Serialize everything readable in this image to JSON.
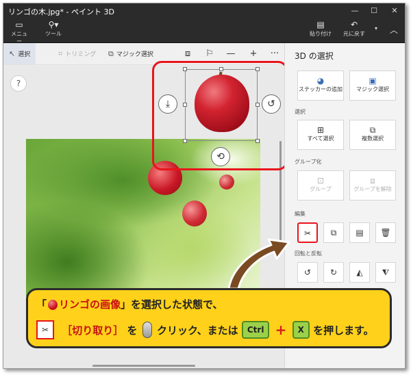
{
  "window": {
    "title": "リンゴの木.jpg* - ペイント 3D"
  },
  "ribbon": {
    "menu_label": "メニュー",
    "tools_label": "ツール",
    "paste_label": "貼り付け",
    "undo_label": "元に戻す"
  },
  "toolbar": {
    "select_label": "選択",
    "crop_label": "トリミング",
    "magic_select_label": "マジック選択"
  },
  "canvas": {
    "help_label": "?"
  },
  "panel": {
    "title": "3D の選択",
    "add_sticker_label": "ステッカーの追加",
    "magic_select_label": "マジック選択",
    "select_section": "選択",
    "select_all_label": "すべて選択",
    "multi_select_label": "複数選択",
    "group_section": "グループ化",
    "group_label": "グループ",
    "ungroup_label": "グループを解除",
    "edit_section": "編集",
    "rotate_section": "回転と反転"
  },
  "callout": {
    "open_bracket": "「",
    "image_name": "リンゴの画像",
    "line1_rest": "」を選択した状態で、",
    "cut_label": "［切り取り］",
    "particle_wo": "を",
    "click_text": "クリック、または",
    "key_ctrl": "Ctrl",
    "plus": "+",
    "key_x": "X",
    "press_text": "を押します。"
  },
  "colors": {
    "accent_red": "#e8141b",
    "callout_yellow": "#ffd11a",
    "key_green": "#9bd14a"
  }
}
